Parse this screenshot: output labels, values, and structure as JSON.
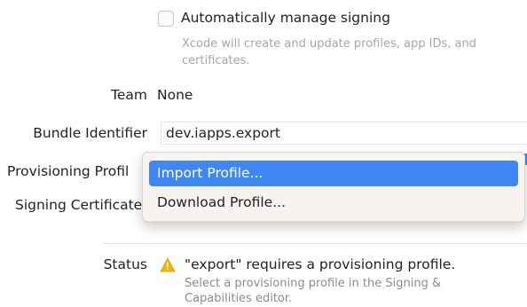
{
  "signing": {
    "auto_manage_label": "Automatically manage signing",
    "auto_manage_checked": false,
    "auto_manage_desc_line1": "Xcode will create and update profiles, app IDs, and",
    "auto_manage_desc_line2": "certificates."
  },
  "team": {
    "label": "Team",
    "value": "None"
  },
  "bundle_identifier": {
    "label": "Bundle Identifier",
    "value": "dev.iapps.export"
  },
  "provisioning_profile": {
    "label": "Provisioning Profil"
  },
  "signing_certificate": {
    "label": "Signing Certificate"
  },
  "menu": {
    "items": [
      {
        "label": "Import Profile...",
        "selected": true
      },
      {
        "label": "Download Profile...",
        "selected": false
      }
    ]
  },
  "status": {
    "label": "Status",
    "icon": "warning-icon",
    "message": "\"export\" requires a provisioning profile.",
    "detail_line1": "Select a provisioning profile in the Signing &",
    "detail_line2": "Capabilities editor."
  },
  "colors": {
    "accent": "#3f87f3",
    "warning": "#f5b400",
    "secondary_text": "#a6a6a6"
  }
}
